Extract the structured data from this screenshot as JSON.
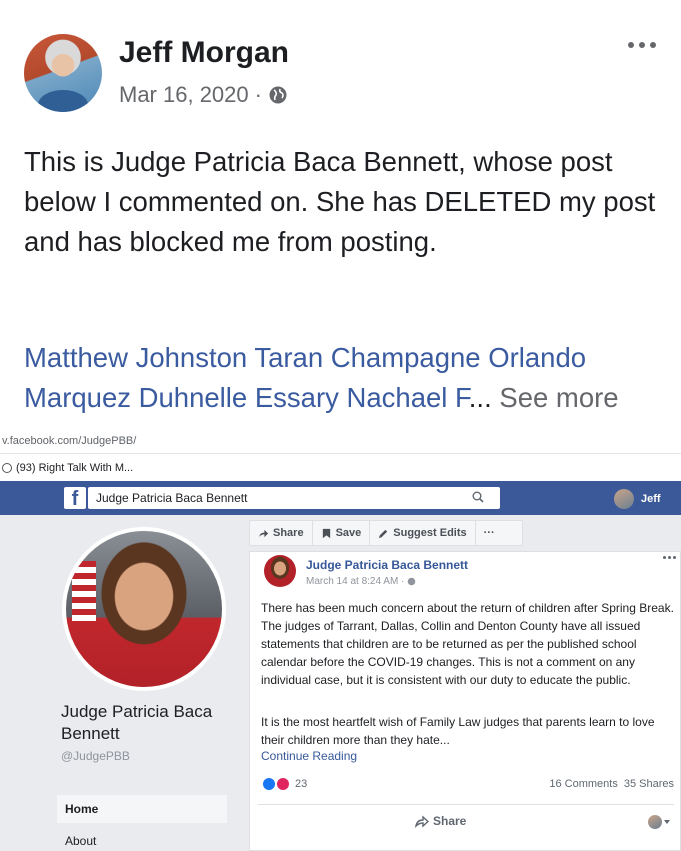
{
  "post": {
    "author": "Jeff Morgan",
    "date": "Mar 16, 2020",
    "date_sep": "·",
    "audience_icon": "globe-icon",
    "text": "This is Judge Patricia Baca Bennett, whose post below I commented on.  She has DELETED my post and has blocked me from posting.",
    "tags": "Matthew Johnston Taran Champagne Orlando Marquez Duhnelle Essary Nachael F",
    "ellipsis": "...",
    "see_more": "See more"
  },
  "screenshot": {
    "url": "v.facebook.com/JudgePBB/",
    "tab_title": "(93) Right Talk With M...",
    "fb_logo": "f",
    "search_value": "Judge Patricia Baca Bennett",
    "user_name": "Jeff",
    "page": {
      "name": "Judge Patricia Baca Bennett",
      "handle": "@JudgePBB",
      "nav": {
        "home": "Home",
        "about": "About"
      }
    },
    "actions": {
      "share": "Share",
      "save": "Save",
      "suggest": "Suggest Edits",
      "more": "···"
    },
    "card": {
      "author": "Judge Patricia Baca Bennett",
      "date": "March 14 at 8:24 AM ·",
      "p1": "There has been much concern about the return of children after Spring Break. The judges of Tarrant, Dallas, Collin and Denton County have all issued statements that children are to be returned as per the published school calendar before the COVID-19 changes. This is not a comment on any individual case, but it is consistent with our duty to educate the public.",
      "p2": "It is the most heartfelt wish of Family Law judges that parents learn to love their children more than they hate...",
      "continue": "Continue Reading",
      "reaction_count": "23",
      "comments": "16 Comments",
      "shares": "35 Shares",
      "share_button": "Share"
    }
  },
  "colors": {
    "fb_blue": "#3b5998",
    "link_blue": "#3a5ba0",
    "like": "#1877f2",
    "love": "#e0245e"
  }
}
